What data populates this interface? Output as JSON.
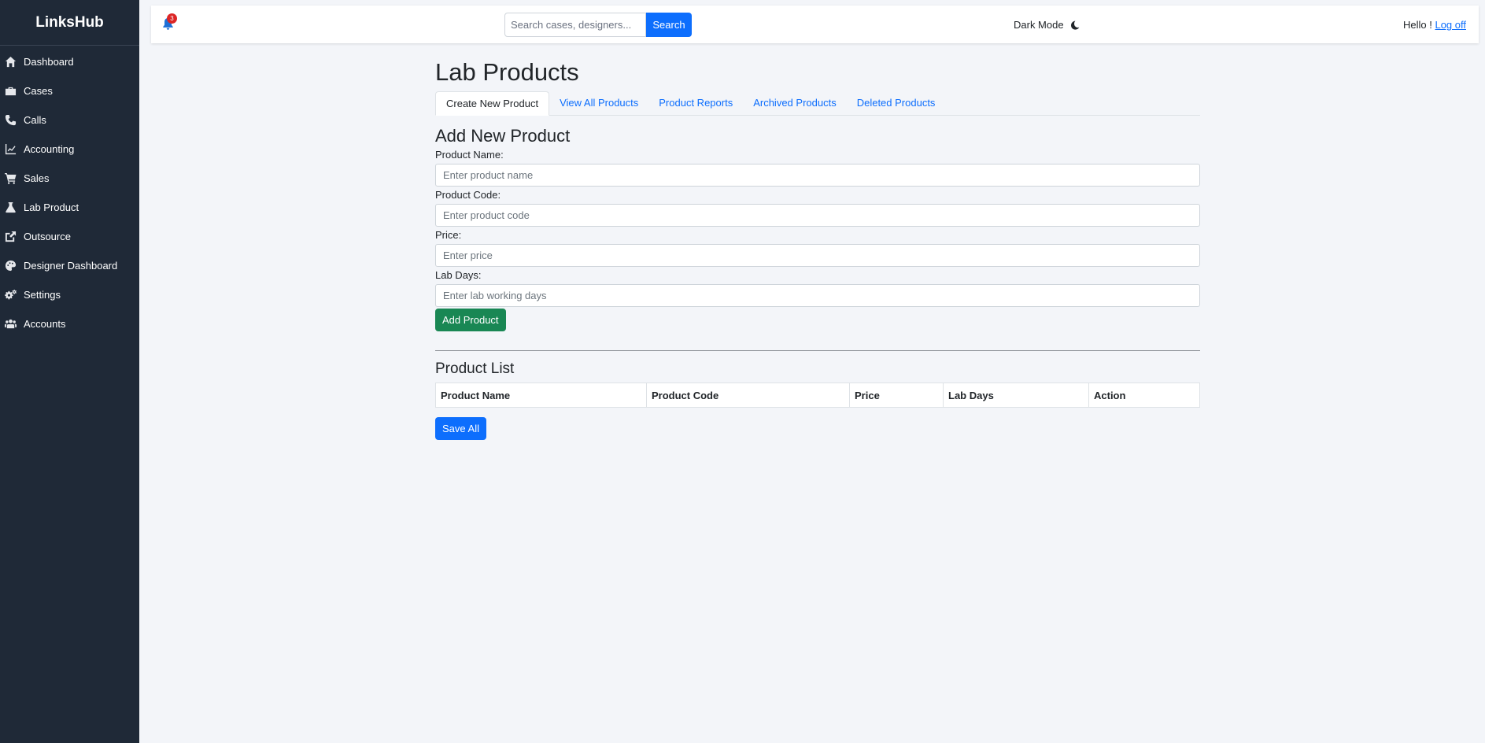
{
  "app": {
    "brand": "LinksHub"
  },
  "sidebar": {
    "items": [
      {
        "label": "Dashboard",
        "icon": "home-icon"
      },
      {
        "label": "Cases",
        "icon": "briefcase-icon"
      },
      {
        "label": "Calls",
        "icon": "phone-icon"
      },
      {
        "label": "Accounting",
        "icon": "chart-line-icon"
      },
      {
        "label": "Sales",
        "icon": "cart-icon"
      },
      {
        "label": "Lab Product",
        "icon": "flask-icon"
      },
      {
        "label": "Outsource",
        "icon": "external-link-icon"
      },
      {
        "label": "Designer Dashboard",
        "icon": "palette-icon"
      },
      {
        "label": "Settings",
        "icon": "gears-icon"
      },
      {
        "label": "Accounts",
        "icon": "users-icon"
      }
    ]
  },
  "topbar": {
    "notification_count": "3",
    "search_placeholder": "Search cases, designers...",
    "search_button": "Search",
    "dark_mode_label": "Dark Mode",
    "greeting": "Hello !",
    "logoff": "Log off"
  },
  "main": {
    "page_title": "Lab Products",
    "tabs": [
      {
        "label": "Create New Product",
        "active": true
      },
      {
        "label": "View All Products"
      },
      {
        "label": "Product Reports"
      },
      {
        "label": "Archived Products"
      },
      {
        "label": "Deleted Products"
      }
    ],
    "form": {
      "title": "Add New Product",
      "fields": [
        {
          "label": "Product Name:",
          "placeholder": "Enter product name",
          "value": ""
        },
        {
          "label": "Product Code:",
          "placeholder": "Enter product code",
          "value": ""
        },
        {
          "label": "Price:",
          "placeholder": "Enter price",
          "value": ""
        },
        {
          "label": "Lab Days:",
          "placeholder": "Enter lab working days",
          "value": ""
        }
      ],
      "submit": "Add Product"
    },
    "list": {
      "title": "Product List",
      "columns": [
        "Product Name",
        "Product Code",
        "Price",
        "Lab Days",
        "Action"
      ],
      "rows": [],
      "save_all": "Save All"
    }
  },
  "colors": {
    "sidebar_bg": "#1f2937",
    "primary": "#0d6efd",
    "success": "#198754",
    "badge": "#dc2626"
  }
}
